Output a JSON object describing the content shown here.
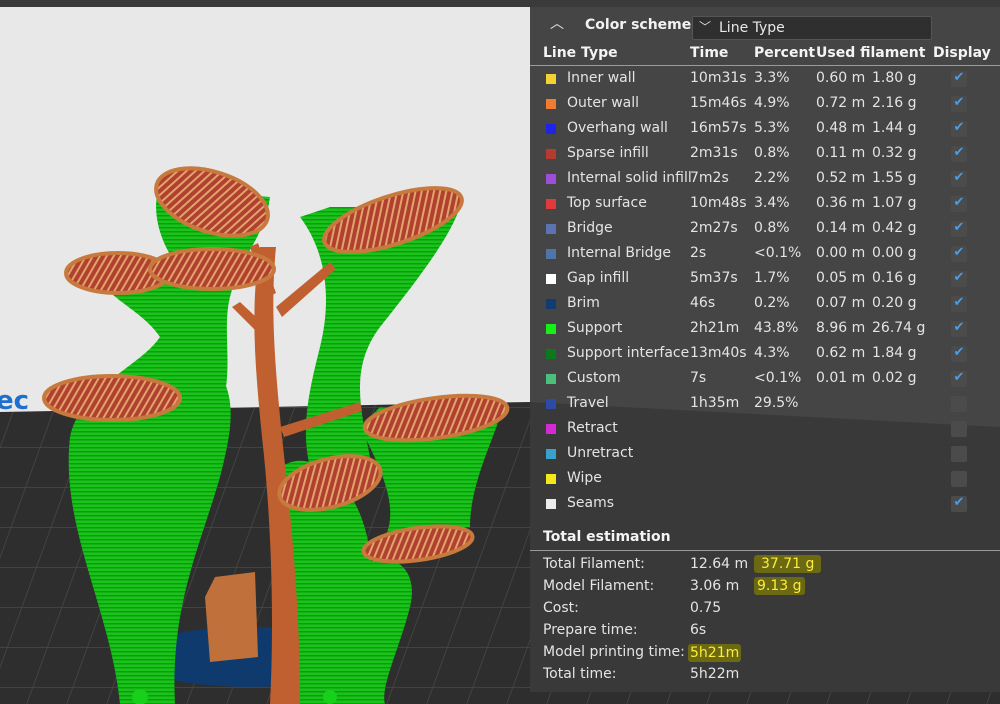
{
  "panel": {
    "scheme_label": "Color scheme",
    "scheme_value": "Line Type",
    "headers": {
      "line_type": "Line Type",
      "time": "Time",
      "percent": "Percent",
      "used_filament": "Used filament",
      "display": "Display"
    },
    "rows": [
      {
        "name": "Inner wall",
        "color": "#f5d234",
        "time": "10m31s",
        "percent": "3.3%",
        "length": "0.60 m",
        "weight": "1.80 g",
        "checked": true
      },
      {
        "name": "Outer wall",
        "color": "#f07c2f",
        "time": "15m46s",
        "percent": "4.9%",
        "length": "0.72 m",
        "weight": "2.16 g",
        "checked": true
      },
      {
        "name": "Overhang wall",
        "color": "#1f24e6",
        "time": "16m57s",
        "percent": "5.3%",
        "length": "0.48 m",
        "weight": "1.44 g",
        "checked": true
      },
      {
        "name": "Sparse infill",
        "color": "#b53a30",
        "time": "2m31s",
        "percent": "0.8%",
        "length": "0.11 m",
        "weight": "0.32 g",
        "checked": true
      },
      {
        "name": "Internal solid infill",
        "color": "#9c4fd6",
        "time": "7m2s",
        "percent": "2.2%",
        "length": "0.52 m",
        "weight": "1.55 g",
        "checked": true
      },
      {
        "name": "Top surface",
        "color": "#e23a3a",
        "time": "10m48s",
        "percent": "3.4%",
        "length": "0.36 m",
        "weight": "1.07 g",
        "checked": true
      },
      {
        "name": "Bridge",
        "color": "#5b73b0",
        "time": "2m27s",
        "percent": "0.8%",
        "length": "0.14 m",
        "weight": "0.42 g",
        "checked": true
      },
      {
        "name": "Internal Bridge",
        "color": "#4f74a8",
        "time": "2s",
        "percent": "<0.1%",
        "length": "0.00 m",
        "weight": "0.00 g",
        "checked": true
      },
      {
        "name": "Gap infill",
        "color": "#ffffff",
        "time": "5m37s",
        "percent": "1.7%",
        "length": "0.05 m",
        "weight": "0.16 g",
        "checked": true
      },
      {
        "name": "Brim",
        "color": "#0f3c72",
        "time": "46s",
        "percent": "0.2%",
        "length": "0.07 m",
        "weight": "0.20 g",
        "checked": true
      },
      {
        "name": "Support",
        "color": "#16f016",
        "time": "2h21m",
        "percent": "43.8%",
        "length": "8.96 m",
        "weight": "26.74 g",
        "checked": true
      },
      {
        "name": "Support interface",
        "color": "#0c7a1a",
        "time": "13m40s",
        "percent": "4.3%",
        "length": "0.62 m",
        "weight": "1.84 g",
        "checked": true
      },
      {
        "name": "Custom",
        "color": "#4bc07c",
        "time": "7s",
        "percent": "<0.1%",
        "length": "0.01 m",
        "weight": "0.02 g",
        "checked": true
      },
      {
        "name": "Travel",
        "color": "#2c4aa6",
        "time": "1h35m",
        "percent": "29.5%",
        "length": "",
        "weight": "",
        "checked": false
      },
      {
        "name": "Retract",
        "color": "#d42ad4",
        "time": "",
        "percent": "",
        "length": "",
        "weight": "",
        "checked": false
      },
      {
        "name": "Unretract",
        "color": "#3aa0cc",
        "time": "",
        "percent": "",
        "length": "",
        "weight": "",
        "checked": false
      },
      {
        "name": "Wipe",
        "color": "#f2e81a",
        "time": "",
        "percent": "",
        "length": "",
        "weight": "",
        "checked": false
      },
      {
        "name": "Seams",
        "color": "#ececec",
        "time": "",
        "percent": "",
        "length": "",
        "weight": "",
        "checked": true
      }
    ],
    "total_estimation": {
      "title": "Total estimation",
      "total_filament_label": "Total Filament:",
      "total_filament_length": "12.64 m",
      "total_filament_weight": "37.71 g",
      "model_filament_label": "Model Filament:",
      "model_filament_length": "3.06 m",
      "model_filament_weight": "9.13 g",
      "cost_label": "Cost:",
      "cost_value": "0.75",
      "prepare_label": "Prepare time:",
      "prepare_value": "6s",
      "model_print_label": "Model printing time:",
      "model_print_value": "5h21m",
      "total_time_label": "Total time:",
      "total_time_value": "5h22m"
    }
  },
  "viewport": {
    "bed_logo_fragment": "ec"
  }
}
